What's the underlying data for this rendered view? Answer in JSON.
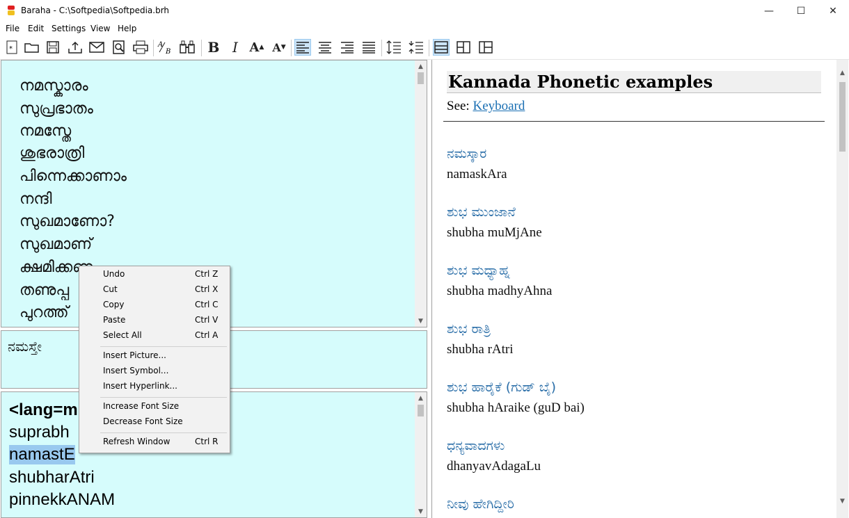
{
  "window": {
    "title": "Baraha - C:\\Softpedia\\Softpedia.brh",
    "minimize": "—",
    "maximize": "☐",
    "close": "✕"
  },
  "menu": [
    "File",
    "Edit",
    "Settings",
    "View",
    "Help"
  ],
  "toolbar": {
    "font_bigger": "A",
    "font_smaller": "A",
    "bold": "B",
    "italic": "I"
  },
  "editor": {
    "malayalam_lines": [
      "നമസ്കാരം",
      "സുപ്രഭാതം",
      "നമസ്തേ",
      "ശുഭരാത്രി",
      "പിന്നെക്കാണാം",
      "നന്ദി",
      "സുഖമാണോ?",
      "സുഖമാണ്",
      "ക്ഷമിക്കണം",
      "തണുപ്പ",
      "പുറത്ത്"
    ],
    "preview_text": "ನಮಸ್ತೇ",
    "roman_lines": [
      "<lang=m",
      "suprabh",
      "namastE",
      "shubharAtri",
      "pinnekkANAM"
    ]
  },
  "help": {
    "heading": "Kannada Phonetic examples",
    "see_prefix": "See:",
    "see_link": "Keyboard",
    "examples": [
      {
        "kannada": "ನಮಸ್ಕಾರ",
        "roman": "namaskAra"
      },
      {
        "kannada": "ಶುಭ ಮುಂಜಾನೆ",
        "roman": "shubha muMjAne"
      },
      {
        "kannada": "ಶುಭ ಮಧ್ಯಾಹ್ನ",
        "roman": "shubha madhyAhna"
      },
      {
        "kannada": "ಶುಭ ರಾತ್ರಿ",
        "roman": "shubha rAtri"
      },
      {
        "kannada": "ಶುಭ ಹಾರೈಕೆ (ಗುಡ್ ಬೈ)",
        "roman": "shubha hAraike (guD bai)"
      },
      {
        "kannada": "ಧನ್ಯವಾದಗಳು",
        "roman": "dhanyavAdagaLu"
      },
      {
        "kannada": "ನೀವು ಹೇಗಿದ್ದೀರಿ",
        "roman": ""
      }
    ]
  },
  "context_menu": {
    "items": [
      {
        "label": "Undo",
        "shortcut": "Ctrl Z"
      },
      {
        "label": "Cut",
        "shortcut": "Ctrl X"
      },
      {
        "label": "Copy",
        "shortcut": "Ctrl C"
      },
      {
        "label": "Paste",
        "shortcut": "Ctrl V"
      },
      {
        "label": "Select All",
        "shortcut": "Ctrl A"
      },
      {
        "label": "Insert Picture...",
        "shortcut": ""
      },
      {
        "label": "Insert Symbol...",
        "shortcut": ""
      },
      {
        "label": "Insert Hyperlink...",
        "shortcut": ""
      },
      {
        "label": "Increase Font Size",
        "shortcut": ""
      },
      {
        "label": "Decrease Font Size",
        "shortcut": ""
      },
      {
        "label": "Refresh Window",
        "shortcut": "Ctrl R"
      }
    ]
  },
  "colors": {
    "editor_bg": "#d6fcfc",
    "link": "#1a6fb3",
    "kannada_text": "#2a6ea8",
    "selection": "#99c9ef",
    "active_tool": "#cce4f7"
  }
}
